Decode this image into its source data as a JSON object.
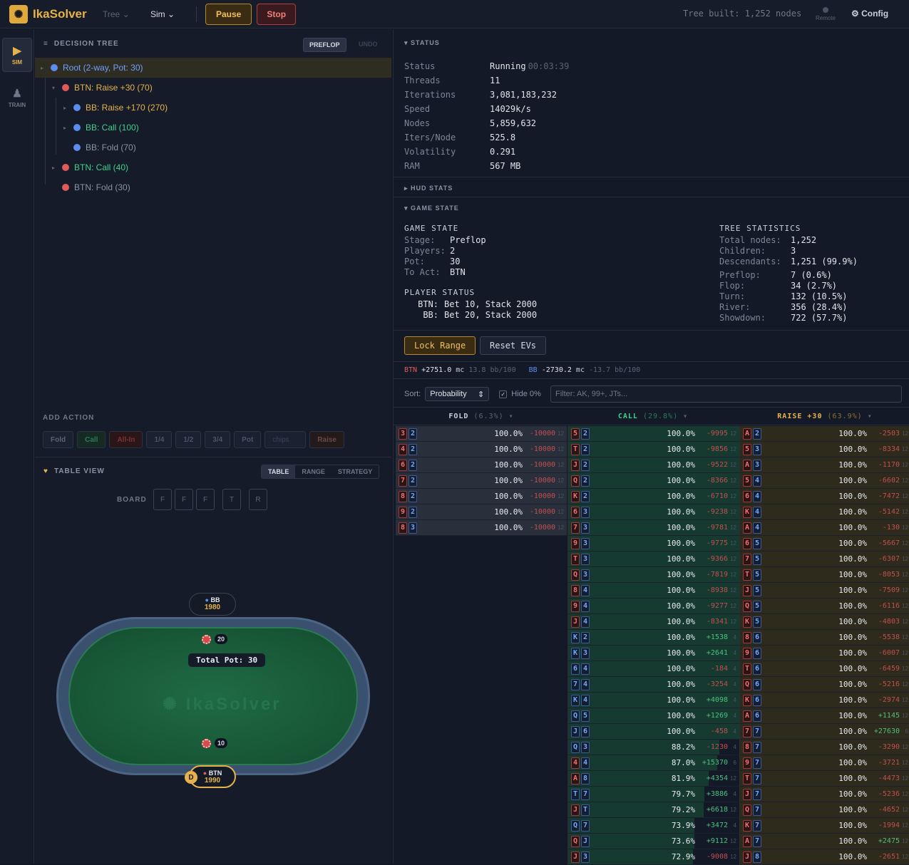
{
  "topbar": {
    "brand": "IkaSolver",
    "menus": [
      {
        "label": "Tree"
      },
      {
        "label": "Sim"
      }
    ],
    "pause": "Pause",
    "stop": "Stop",
    "tree_built": "Tree built: 1,252 nodes",
    "remote": "Remote",
    "config": "Config"
  },
  "rail": {
    "sim": "SIM",
    "train": "TRAIN"
  },
  "tree": {
    "title": "DECISION TREE",
    "preflop_btn": "PREFLOP",
    "undo": "UNDO",
    "nodes": [
      {
        "label": "Root (2-way, Pot: 30)",
        "color": "#5b8dee",
        "text_color": "#6fa0ff"
      },
      {
        "label": "BTN: Raise +30 (70)",
        "color": "#e05a5a",
        "text_color": "#e6b24a"
      },
      {
        "label": "BB: Raise +170 (270)",
        "color": "#5b8dee",
        "text_color": "#e6b24a"
      },
      {
        "label": "BB: Call (100)",
        "color": "#5b8dee",
        "text_color": "#3fd08a"
      },
      {
        "label": "BB: Fold (70)",
        "color": "#5b8dee",
        "text_color": "#8a93a4"
      },
      {
        "label": "BTN: Call (40)",
        "color": "#e05a5a",
        "text_color": "#3fd08a"
      },
      {
        "label": "BTN: Fold (30)",
        "color": "#e05a5a",
        "text_color": "#8a93a4"
      }
    ],
    "add_action": "ADD ACTION",
    "actions": [
      "Fold",
      "Call",
      "All-In",
      "1/4",
      "1/2",
      "3/4",
      "Pot",
      "chips",
      "Raise"
    ]
  },
  "tableview": {
    "title": "TABLE VIEW",
    "tabs": [
      "TABLE",
      "RANGE",
      "STRATEGY"
    ],
    "board_label": "BOARD",
    "board": [
      "F",
      "F",
      "F",
      "T",
      "R"
    ],
    "watermark": "IkaSolver",
    "pot_label": "Total Pot: 30",
    "bb_chip": "20",
    "btn_chip": "10",
    "bb": {
      "name": "BB",
      "stack": "1980"
    },
    "btn": {
      "name": "BTN",
      "stack": "1990"
    },
    "dealer": "D"
  },
  "status": {
    "title": "STATUS",
    "rows": [
      [
        "Status",
        "Running"
      ],
      [
        "Threads",
        "11"
      ],
      [
        "Iterations",
        "3,081,183,232"
      ],
      [
        "Speed",
        "14029k/s"
      ],
      [
        "Nodes",
        "5,859,632"
      ],
      [
        "Iters/Node",
        "525.8"
      ],
      [
        "Volatility",
        "0.291"
      ],
      [
        "RAM",
        "567 MB"
      ]
    ],
    "time": "00:03:39"
  },
  "hud": {
    "title": "HUD STATS"
  },
  "gamestate": {
    "title": "GAME STATE",
    "gs_title": "GAME STATE",
    "stage_k": "Stage:",
    "stage": "Preflop",
    "players_k": "Players:",
    "players": "2",
    "pot_k": "Pot:",
    "pot": "30",
    "toact_k": "To Act:",
    "toact": "BTN",
    "ps_title": "PLAYER STATUS",
    "ps": [
      {
        "k": "BTN:",
        "v": "Bet 10, Stack 2000"
      },
      {
        "k": "BB:",
        "v": "Bet 20, Stack 2000"
      }
    ],
    "ts_title": "TREE STATISTICS",
    "ts": [
      [
        "Total nodes:",
        "1,252"
      ],
      [
        "Children:",
        "3"
      ],
      [
        "Descendants:",
        "1,251 (99.9%)"
      ],
      [
        "Preflop:",
        "7 (0.6%)"
      ],
      [
        "Flop:",
        "34 (2.7%)"
      ],
      [
        "Turn:",
        "132 (10.5%)"
      ],
      [
        "River:",
        "356 (28.4%)"
      ],
      [
        "Showdown:",
        "722 (57.7%)"
      ]
    ]
  },
  "controls": {
    "lock": "Lock Range",
    "reset": "Reset EVs",
    "ev": {
      "btn_name": "BTN",
      "btn_val": "+2751.0",
      "mc": "mc",
      "btn_bb": "13.8 bb/100",
      "bb_name": "BB",
      "bb_val": "-2730.2",
      "bb_bb": "-13.7 bb/100"
    },
    "sort_label": "Sort:",
    "sort_value": "Probability",
    "hide_label": "Hide 0%",
    "filter_placeholder": "Filter: AK, 99+, JTs..."
  },
  "columns": [
    {
      "title": "FOLD",
      "pct": "(6.3%)",
      "color": "#c9cfda",
      "bar": "#2a2f3c",
      "rows": [
        [
          "3",
          "r",
          "2",
          "b",
          "100.0%",
          "-10000",
          "12"
        ],
        [
          "4",
          "r",
          "2",
          "b",
          "100.0%",
          "-10000",
          "12"
        ],
        [
          "6",
          "r",
          "2",
          "b",
          "100.0%",
          "-10000",
          "12"
        ],
        [
          "7",
          "r",
          "2",
          "b",
          "100.0%",
          "-10000",
          "12"
        ],
        [
          "8",
          "r",
          "2",
          "b",
          "100.0%",
          "-10000",
          "12"
        ],
        [
          "9",
          "r",
          "2",
          "b",
          "100.0%",
          "-10000",
          "12"
        ],
        [
          "8",
          "r",
          "3",
          "b",
          "100.0%",
          "-10000",
          "12"
        ]
      ]
    },
    {
      "title": "CALL",
      "pct": "(29.8%)",
      "color": "#3fd08a",
      "bar": "#163a30",
      "rows": [
        [
          "5",
          "r",
          "2",
          "b",
          "100.0%",
          "-9995",
          "12"
        ],
        [
          "T",
          "r",
          "2",
          "b",
          "100.0%",
          "-9856",
          "12"
        ],
        [
          "J",
          "r",
          "2",
          "b",
          "100.0%",
          "-9522",
          "12"
        ],
        [
          "Q",
          "r",
          "2",
          "b",
          "100.0%",
          "-8366",
          "12"
        ],
        [
          "K",
          "r",
          "2",
          "b",
          "100.0%",
          "-6710",
          "12"
        ],
        [
          "6",
          "r",
          "3",
          "b",
          "100.0%",
          "-9238",
          "12"
        ],
        [
          "7",
          "r",
          "3",
          "b",
          "100.0%",
          "-9781",
          "12"
        ],
        [
          "9",
          "r",
          "3",
          "b",
          "100.0%",
          "-9775",
          "12"
        ],
        [
          "T",
          "r",
          "3",
          "b",
          "100.0%",
          "-9366",
          "12"
        ],
        [
          "Q",
          "r",
          "3",
          "b",
          "100.0%",
          "-7819",
          "12"
        ],
        [
          "8",
          "r",
          "4",
          "b",
          "100.0%",
          "-8938",
          "12"
        ],
        [
          "9",
          "r",
          "4",
          "b",
          "100.0%",
          "-9277",
          "12"
        ],
        [
          "J",
          "r",
          "4",
          "b",
          "100.0%",
          "-8341",
          "12"
        ],
        [
          "K",
          "b",
          "2",
          "b",
          "100.0%",
          "+1538",
          "4"
        ],
        [
          "K",
          "b",
          "3",
          "b",
          "100.0%",
          "+2641",
          "4"
        ],
        [
          "6",
          "b",
          "4",
          "b",
          "100.0%",
          "-184",
          "4"
        ],
        [
          "7",
          "b",
          "4",
          "b",
          "100.0%",
          "-3254",
          "4"
        ],
        [
          "K",
          "b",
          "4",
          "b",
          "100.0%",
          "+4098",
          "4"
        ],
        [
          "Q",
          "b",
          "5",
          "b",
          "100.0%",
          "+1269",
          "4"
        ],
        [
          "J",
          "b",
          "6",
          "b",
          "100.0%",
          "-458",
          "4"
        ],
        [
          "Q",
          "b",
          "3",
          "b",
          "88.2%",
          "-1230",
          "4"
        ],
        [
          "4",
          "r",
          "4",
          "b",
          "87.0%",
          "+15370",
          "6"
        ],
        [
          "A",
          "r",
          "8",
          "b",
          "81.9%",
          "+4354",
          "12"
        ],
        [
          "T",
          "b",
          "7",
          "b",
          "79.7%",
          "+3886",
          "4"
        ],
        [
          "J",
          "r",
          "T",
          "b",
          "79.2%",
          "+6618",
          "12"
        ],
        [
          "Q",
          "b",
          "7",
          "b",
          "73.9%",
          "+3472",
          "4"
        ],
        [
          "Q",
          "r",
          "J",
          "b",
          "73.6%",
          "+9112",
          "12"
        ],
        [
          "J",
          "r",
          "3",
          "b",
          "72.9%",
          "-9008",
          "12"
        ]
      ]
    },
    {
      "title": "RAISE +30",
      "pct": "(63.9%)",
      "color": "#e6b24a",
      "bar": "#2e2a1c",
      "rows": [
        [
          "A",
          "r",
          "2",
          "b",
          "100.0%",
          "-2503",
          "12"
        ],
        [
          "5",
          "r",
          "3",
          "b",
          "100.0%",
          "-8334",
          "12"
        ],
        [
          "A",
          "r",
          "3",
          "b",
          "100.0%",
          "-1170",
          "12"
        ],
        [
          "5",
          "r",
          "4",
          "b",
          "100.0%",
          "-6602",
          "12"
        ],
        [
          "6",
          "r",
          "4",
          "b",
          "100.0%",
          "-7472",
          "12"
        ],
        [
          "K",
          "r",
          "4",
          "b",
          "100.0%",
          "-5142",
          "12"
        ],
        [
          "A",
          "r",
          "4",
          "b",
          "100.0%",
          "-130",
          "12"
        ],
        [
          "6",
          "r",
          "5",
          "b",
          "100.0%",
          "-5667",
          "12"
        ],
        [
          "7",
          "r",
          "5",
          "b",
          "100.0%",
          "-6307",
          "12"
        ],
        [
          "T",
          "r",
          "5",
          "b",
          "100.0%",
          "-8053",
          "12"
        ],
        [
          "J",
          "r",
          "5",
          "b",
          "100.0%",
          "-7509",
          "12"
        ],
        [
          "Q",
          "r",
          "5",
          "b",
          "100.0%",
          "-6116",
          "12"
        ],
        [
          "K",
          "r",
          "5",
          "b",
          "100.0%",
          "-4803",
          "12"
        ],
        [
          "8",
          "r",
          "6",
          "b",
          "100.0%",
          "-5538",
          "12"
        ],
        [
          "9",
          "r",
          "6",
          "b",
          "100.0%",
          "-6007",
          "12"
        ],
        [
          "T",
          "r",
          "6",
          "b",
          "100.0%",
          "-6459",
          "12"
        ],
        [
          "Q",
          "r",
          "6",
          "b",
          "100.0%",
          "-5216",
          "12"
        ],
        [
          "K",
          "r",
          "6",
          "b",
          "100.0%",
          "-2974",
          "12"
        ],
        [
          "A",
          "r",
          "6",
          "b",
          "100.0%",
          "+1145",
          "12"
        ],
        [
          "7",
          "r",
          "7",
          "b",
          "100.0%",
          "+27630",
          "6"
        ],
        [
          "8",
          "r",
          "7",
          "b",
          "100.0%",
          "-3290",
          "12"
        ],
        [
          "9",
          "r",
          "7",
          "b",
          "100.0%",
          "-3721",
          "12"
        ],
        [
          "T",
          "r",
          "7",
          "b",
          "100.0%",
          "-4473",
          "12"
        ],
        [
          "J",
          "r",
          "7",
          "b",
          "100.0%",
          "-5236",
          "12"
        ],
        [
          "Q",
          "r",
          "7",
          "b",
          "100.0%",
          "-4652",
          "12"
        ],
        [
          "K",
          "r",
          "7",
          "b",
          "100.0%",
          "-1994",
          "12"
        ],
        [
          "A",
          "r",
          "7",
          "b",
          "100.0%",
          "+2475",
          "12"
        ],
        [
          "J",
          "r",
          "8",
          "b",
          "100.0%",
          "-2651",
          "12"
        ]
      ]
    }
  ]
}
